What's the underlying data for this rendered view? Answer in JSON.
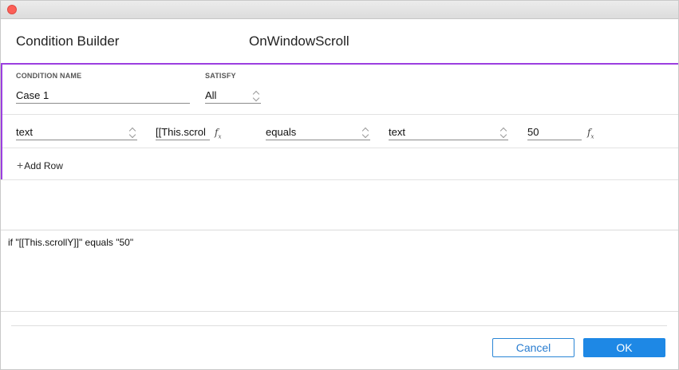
{
  "header": {
    "title": "Condition Builder",
    "event_name": "OnWindowScroll"
  },
  "condition": {
    "name_label": "CONDITION NAME",
    "name_value": "Case 1",
    "satisfy_label": "SATISFY",
    "satisfy_value": "All"
  },
  "row": {
    "left_type": "text",
    "left_value": "[[This.scrol",
    "operator": "equals",
    "right_type": "text",
    "right_value": "50"
  },
  "add_row_label": "Add Row",
  "preview_text": "if \"[[This.scrollY]]\" equals \"50\"",
  "buttons": {
    "cancel": "Cancel",
    "ok": "OK"
  },
  "colors": {
    "accent_purple": "#9b3fe0",
    "primary_blue": "#1e88e5",
    "close_red": "#fc5f57"
  }
}
